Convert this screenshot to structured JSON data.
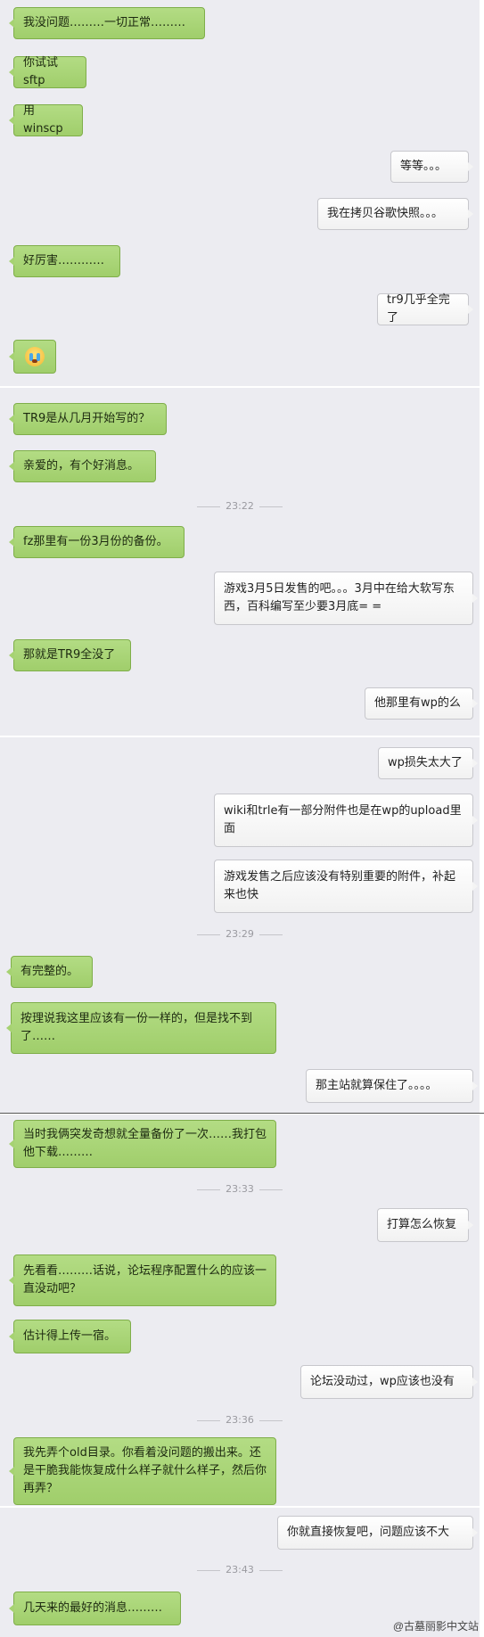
{
  "messages": [
    {
      "side": "left",
      "text": "我没问题………一切正常………"
    },
    {
      "side": "left",
      "text": "你试试sftp"
    },
    {
      "side": "left",
      "text": "用winscp"
    },
    {
      "side": "right",
      "text": "等等。。。"
    },
    {
      "side": "right",
      "text": "我在拷贝谷歌快照。。。"
    },
    {
      "side": "left",
      "text": "好厉害…………"
    },
    {
      "side": "right",
      "text": "tr9几乎全完了"
    },
    {
      "side": "left",
      "emoji": "crying-face-icon"
    },
    {
      "side": "left",
      "text": "TR9是从几月开始写的？"
    },
    {
      "side": "left",
      "text": "亲爱的，有个好消息。"
    },
    {
      "side": "left",
      "text": "fz那里有一份3月份的备份。"
    },
    {
      "side": "right",
      "text": "游戏3月5日发售的吧。。。3月中在给大软写东西，百科编写至少要3月底= ="
    },
    {
      "side": "left",
      "text": "那就是TR9全没了"
    },
    {
      "side": "right",
      "text": "他那里有wp的么"
    },
    {
      "side": "right",
      "text": "wp损失太大了"
    },
    {
      "side": "right",
      "text": "wiki和trle有一部分附件也是在wp的upload里面"
    },
    {
      "side": "right",
      "text": "游戏发售之后应该没有特别重要的附件，补起来也快"
    },
    {
      "side": "left",
      "text": "有完整的。"
    },
    {
      "side": "left",
      "text": "按理说我这里应该有一份一样的，但是找不到了……"
    },
    {
      "side": "right",
      "text": "那主站就算保住了。。。。"
    },
    {
      "side": "left",
      "text": "当时我俩突发奇想就全量备份了一次……我打包他下载………"
    },
    {
      "side": "right",
      "text": "打算怎么恢复"
    },
    {
      "side": "left",
      "text": "先看看………话说，论坛程序配置什么的应该一直没动吧？"
    },
    {
      "side": "left",
      "text": "估计得上传一宿。"
    },
    {
      "side": "right",
      "text": "论坛没动过，wp应该也没有"
    },
    {
      "side": "left",
      "text": "我先弄个old目录。你看着没问题的搬出来。还是干脆我能恢复成什么样子就什么样子，然后你再弄？"
    },
    {
      "side": "right",
      "text": "你就直接恢复吧，问题应该不大"
    },
    {
      "side": "left",
      "text": "几天来的最好的消息………"
    }
  ],
  "timestamps": [
    "23:22",
    "23:29",
    "23:33",
    "23:36",
    "23:43"
  ],
  "watermark": "@古墓丽影中文站",
  "colors": {
    "panel_bg": "#ececf1",
    "left_bubble": "#a6d272",
    "right_bubble": "#f4f4f4",
    "timestamp": "#9a9aa0"
  }
}
